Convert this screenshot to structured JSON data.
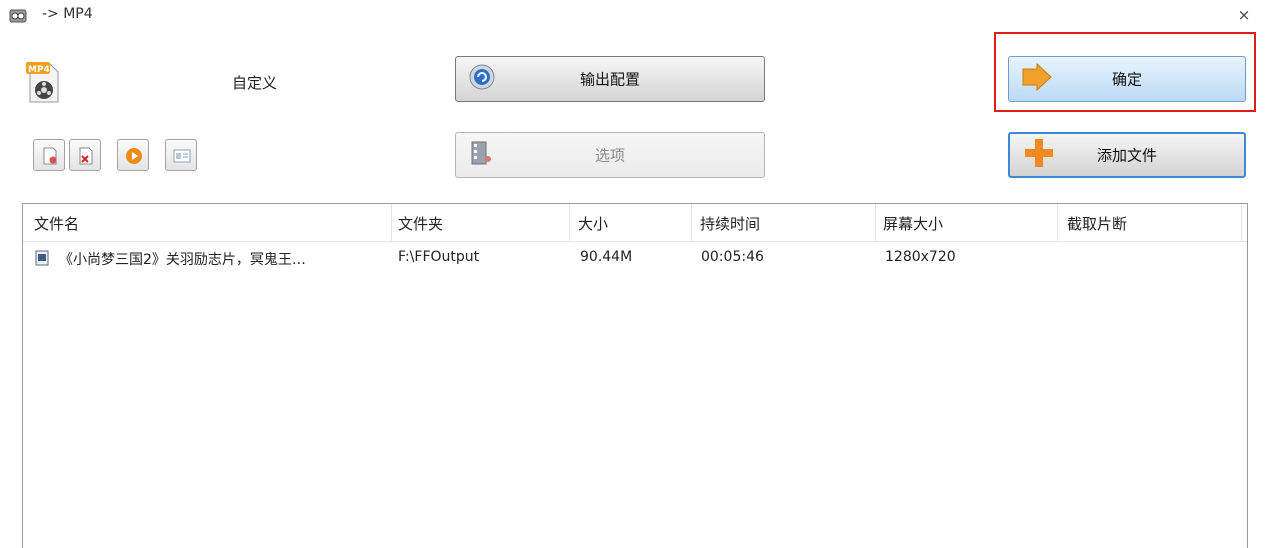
{
  "window": {
    "title": "-> MP4",
    "close_symbol": "×"
  },
  "profile": {
    "label": "自定义"
  },
  "buttons": {
    "output_config": "输出配置",
    "options": "选项",
    "ok": "确定",
    "add_file": "添加文件"
  },
  "colors": {
    "highlight_border": "#e01b1b",
    "ok_button_bg": "#cfe5f9",
    "add_button_border": "#3c8ad1"
  },
  "icons": {
    "title": "app-icon",
    "profile": "mp4-file-icon",
    "output_config": "gear-icon",
    "options": "film-options-icon",
    "ok": "arrow-right-icon",
    "add_file": "plus-icon",
    "toolbar": [
      "remove-file-icon",
      "clear-list-icon",
      "play-icon",
      "info-icon"
    ]
  },
  "table": {
    "columns": [
      "文件名",
      "文件夹",
      "大小",
      "持续时间",
      "屏幕大小",
      "截取片断"
    ],
    "rows": [
      {
        "name": "《小尚梦三国2》关羽励志片，冥鬼王…",
        "folder": "F:\\FFOutput",
        "size": "90.44M",
        "duration": "00:05:46",
        "resolution": "1280x720",
        "clip": ""
      }
    ]
  }
}
